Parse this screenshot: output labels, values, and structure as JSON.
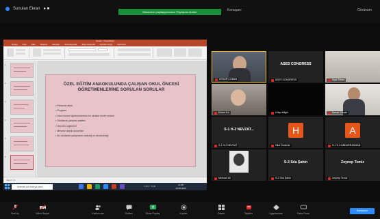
{
  "zoom": {
    "topbar": {
      "meeting_label": "Sunulan Ekran",
      "share_banner": "Ekranınızı paylaşıyorsunuz  Paylaşımı durdur",
      "speaker_label": "Konuşan:",
      "view_label": "Görünüm"
    },
    "controls": [
      {
        "name": "unmute",
        "label": "Sesi Aç"
      },
      {
        "name": "video",
        "label": "Video Başlat"
      },
      {
        "name": "participants",
        "label": "Katılımcılar"
      },
      {
        "name": "chat",
        "label": "Sohbet"
      },
      {
        "name": "share",
        "label": "Ekran Paylaş"
      },
      {
        "name": "record",
        "label": "Kaydet"
      },
      {
        "name": "breakout",
        "label": "Odalar"
      },
      {
        "name": "reactions",
        "label": "Tepkiler"
      },
      {
        "name": "apps",
        "label": "Uygulamalar"
      },
      {
        "name": "more",
        "label": "Daha Fazla"
      }
    ],
    "end_label": "Sonlandır"
  },
  "powerpoint": {
    "title_bar": "Sunu1 - PowerPoint",
    "tabs": [
      "Dosya",
      "Giriş",
      "Ekle",
      "Tasarım",
      "Geçişler",
      "Animasyonlar",
      "Slayt Gösterisi",
      "Gözden Geçir",
      "Görünüm"
    ],
    "slide_title": "ÖZEL EĞİTİM ANAOKULUNDA ÇALIŞAN OKUL ÖNCESİ ÖĞRETMENLERİNE SORULAN SORULAR",
    "bullets": [
      "Personel alımı",
      "Program",
      "Okul öncesi öğretmenlerinin bu okulları tercih nedeni",
      "Okullarda çalışma saatleri",
      "Gözetim eğitimleri",
      "Mesleki olarak durumları",
      "Bu okullarda çalışmanın avantaj ve dezavantajı"
    ],
    "thumb_numbers": [
      "1",
      "2",
      "3",
      "4",
      "5",
      "6"
    ],
    "status_text": "Slayt 6 / 6"
  },
  "windows": {
    "search_placeholder": "Aramak için buraya yazın",
    "clock_time": "21:48",
    "clock_date": "15.05.2020",
    "tray_text": "19°C  ^  TUR"
  },
  "participants": [
    {
      "name": "AYNUR ÇOBAN",
      "type": "video",
      "active": true
    },
    {
      "name": "ASES CONGRESS",
      "type": "name",
      "display": "ASES CONGRESS"
    },
    {
      "name": "Ayşe Dilara",
      "type": "video"
    },
    {
      "name": "Emine Kır",
      "type": "video"
    },
    {
      "name": "Hülya Bilgin",
      "type": "blank"
    },
    {
      "name": "Kemal Yılmaz",
      "type": "video"
    },
    {
      "name": "S-1 H-2 NEVZAT",
      "type": "name",
      "display": "S-1 H-2 NEVZAT..."
    },
    {
      "name": "Hilal Özdemir",
      "type": "avatar",
      "letter": "H",
      "color": "#e6561b"
    },
    {
      "name": "S-1 H-2 ABDURRAHMAN",
      "type": "avatar",
      "letter": "A",
      "color": "#e6561b"
    },
    {
      "name": "Mehmet Ali",
      "type": "photo"
    },
    {
      "name": "S-3 Sıla Şahin",
      "type": "name",
      "display": "S-3 Sıla Şahin"
    },
    {
      "name": "Zeynep Temiz",
      "type": "name",
      "display": "Zeynep Temiz"
    }
  ]
}
